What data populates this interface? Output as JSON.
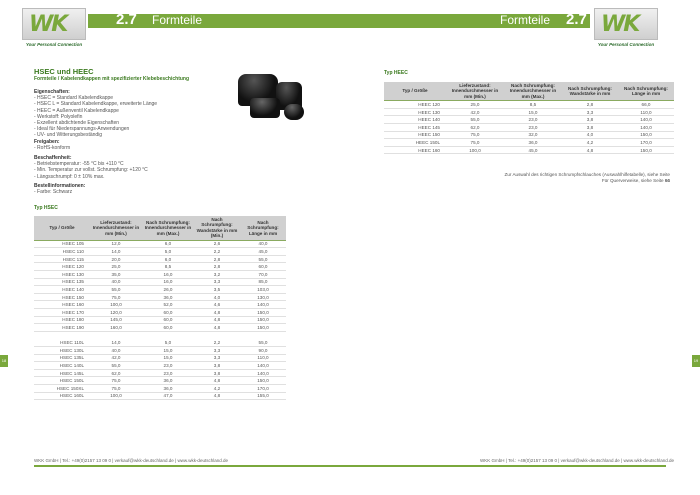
{
  "header": {
    "section_number": "2.7",
    "section_title": "Formteile",
    "logo_text": "WK",
    "logo_tagline": "Your Personal Connection"
  },
  "left": {
    "product_title": "HSEC und HEEC",
    "product_subtitle": "Formteile / Kabelendkappen mit spezifizierter Klebebeschichtung",
    "properties_heading": "Eigenschaften:",
    "properties": [
      "- HSEC = Standard Kabelendkappe",
      "- HSEC L = Standard Kabelendkappe, erweiterte Länge",
      "- HEEC = Außenventil Kabelendkappe",
      "- Werkstoff: Polyolefin",
      "- Exzellent abdichtende Eigenschaften",
      "- Ideal für Niederspannungs-Anwendungen",
      "- UV- und Witterungsbeständig"
    ],
    "approvals_heading": "Freigaben:",
    "approvals": [
      "- RoHS-konform"
    ],
    "finish_heading": "Beschaffenheit:",
    "finish": [
      "- Betriebstemperatur: -55 °C bis +110 °C",
      "- Min. Temperatur zur vollst. Schrumpfung: +120 °C",
      "- Längsschrumpf: 0 ± 10% max."
    ],
    "order_heading": "Bestellinformationen:",
    "order": [
      "- Farbe: Schwarz"
    ],
    "table_label": "Typ HSEC",
    "table": {
      "headers": [
        "Typ / Größe",
        "Lieferzustand: Innendurchmesser in mm (Min.)",
        "Nach Schrumpfung: Innendurchmesser in mm (Max.)",
        "Nach Schrumpfung: Wandstärke in mm (Min.)",
        "Nach Schrumpfung: Länge in mm"
      ],
      "rows_a": [
        [
          "HSEC 105",
          "12,0",
          "6,0",
          "2,6",
          "40,0"
        ],
        [
          "HSEC 110",
          "14,0",
          "5,0",
          "2,2",
          "45,0"
        ],
        [
          "HSEC 115",
          "20,0",
          "6,0",
          "2,8",
          "55,0"
        ],
        [
          "HSEC 120",
          "25,0",
          "8,5",
          "2,8",
          "60,0"
        ],
        [
          "HSEC 130",
          "35,0",
          "16,0",
          "3,2",
          "70,0"
        ],
        [
          "HSEC 135",
          "40,0",
          "16,0",
          "3,3",
          "85,0"
        ],
        [
          "HSEC 140",
          "55,0",
          "26,0",
          "3,5",
          "103,0"
        ],
        [
          "HSEC 150",
          "75,0",
          "36,0",
          "4,0",
          "130,0"
        ],
        [
          "HSEC 160",
          "100,0",
          "52,0",
          "4,6",
          "140,0"
        ],
        [
          "HSEC 170",
          "120,0",
          "60,0",
          "4,8",
          "150,0"
        ],
        [
          "HSEC 180",
          "145,0",
          "60,0",
          "4,8",
          "150,0"
        ],
        [
          "HSEC 190",
          "160,0",
          "60,0",
          "4,8",
          "150,0"
        ]
      ],
      "rows_b": [
        [
          "HSEC 110L",
          "14,0",
          "5,0",
          "2,2",
          "55,0"
        ],
        [
          "HSEC 130L",
          "40,0",
          "15,0",
          "3,3",
          "90,0"
        ],
        [
          "HSEC 135L",
          "42,0",
          "15,0",
          "3,3",
          "110,0"
        ],
        [
          "HSEC 140L",
          "55,0",
          "23,0",
          "3,8",
          "140,0"
        ],
        [
          "HSEC 145L",
          "62,0",
          "23,0",
          "3,8",
          "140,0"
        ],
        [
          "HSEC 150L",
          "75,0",
          "36,0",
          "4,8",
          "150,0"
        ],
        [
          "HSEC 150XL",
          "75,0",
          "36,0",
          "4,2",
          "170,0"
        ],
        [
          "HSEC 160L",
          "100,0",
          "47,0",
          "4,8",
          "155,0"
        ]
      ]
    },
    "footer": "WKK GmbH | Tel.: +49(0)2157 13 09 0 | verkauf@wkk-deutschland.de | www.wkk-deutschland.de"
  },
  "right": {
    "table_label": "Typ HEEC",
    "table": {
      "headers": [
        "Typ / Größe",
        "Lieferzustand: Innendurchmesser in mm (Min.)",
        "Nach Schrumpfung: Innendurchmesser in mm (Max.)",
        "Nach Schrumpfung: Wandstärke in mm",
        "Nach Schrumpfung: Länge in mm"
      ],
      "rows": [
        [
          "HEEC 120",
          "25,0",
          "8,5",
          "2,8",
          "66,0"
        ],
        [
          "HEEC 130",
          "42,0",
          "15,0",
          "3,3",
          "110,0"
        ],
        [
          "HEEC 140",
          "55,0",
          "23,0",
          "3,8",
          "140,0"
        ],
        [
          "HEEC 145",
          "62,0",
          "23,0",
          "3,8",
          "140,0"
        ],
        [
          "HEEC 150",
          "75,0",
          "32,0",
          "4,0",
          "150,0"
        ],
        [
          "HEEC 150L",
          "75,0",
          "36,0",
          "4,2",
          "170,0"
        ],
        [
          "HEEC 160",
          "100,0",
          "45,0",
          "4,8",
          "150,0"
        ]
      ]
    },
    "note_1": "Zur Auswahl des richtigen Schrumpfschlauches (Auswahlhilfetabelle), siehe Seite 64",
    "note_2": "Für Querverweise, siehe Seite 66",
    "footer": "WKK GmbH | Tel.: +49(0)2157 13 09 0 | verkauf@wkk-deutschland.de | www.wkk-deutschland.de"
  },
  "page_tabs": {
    "left": "18",
    "right": "19"
  },
  "colors": {
    "accent": "#7aa83c",
    "title_green": "#3b7a1f"
  }
}
